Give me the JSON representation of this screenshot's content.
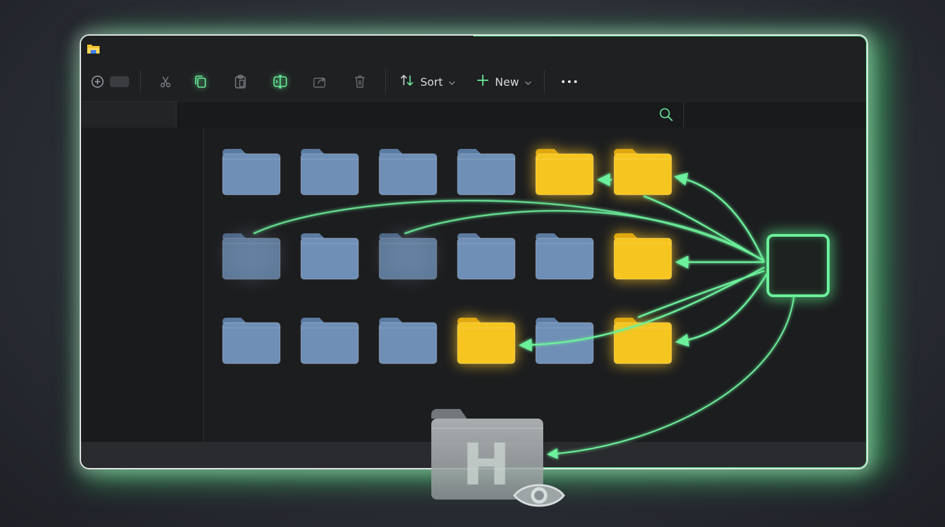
{
  "toolbar": {
    "sort_label": "Sort",
    "new_label": "New"
  },
  "icons": {
    "app": "folder-icon",
    "new_tab": "circle-plus-icon",
    "cut": "scissors-icon",
    "copy": "copy-icon",
    "paste": "clipboard-icon",
    "rename": "rename-icon",
    "share": "share-icon",
    "delete": "trash-icon",
    "sort": "sort-arrows-icon",
    "new": "plus-icon",
    "more": "ellipsis-icon",
    "search": "search-icon",
    "hidden_folder": "hidden-folder-icon",
    "eye": "eye-icon"
  },
  "colors": {
    "accent_green": "#5dea8e",
    "folder_blue": "#6f8fb6",
    "folder_yellow": "#f6c51f",
    "window_bg": "#1c1d1f"
  },
  "hidden_folder_letter": "H",
  "folders": [
    {
      "row": 1,
      "col": 1,
      "state": "normal"
    },
    {
      "row": 1,
      "col": 2,
      "state": "normal"
    },
    {
      "row": 1,
      "col": 3,
      "state": "normal"
    },
    {
      "row": 1,
      "col": 4,
      "state": "normal"
    },
    {
      "row": 1,
      "col": 5,
      "state": "highlighted"
    },
    {
      "row": 1,
      "col": 6,
      "state": "highlighted"
    },
    {
      "row": 2,
      "col": 1,
      "state": "faded"
    },
    {
      "row": 2,
      "col": 2,
      "state": "normal"
    },
    {
      "row": 2,
      "col": 3,
      "state": "faded"
    },
    {
      "row": 2,
      "col": 4,
      "state": "normal"
    },
    {
      "row": 2,
      "col": 5,
      "state": "normal"
    },
    {
      "row": 2,
      "col": 6,
      "state": "highlighted"
    },
    {
      "row": 3,
      "col": 1,
      "state": "normal"
    },
    {
      "row": 3,
      "col": 2,
      "state": "normal"
    },
    {
      "row": 3,
      "col": 3,
      "state": "normal"
    },
    {
      "row": 3,
      "col": 4,
      "state": "highlighted"
    },
    {
      "row": 3,
      "col": 5,
      "state": "normal"
    },
    {
      "row": 3,
      "col": 6,
      "state": "highlighted"
    }
  ]
}
